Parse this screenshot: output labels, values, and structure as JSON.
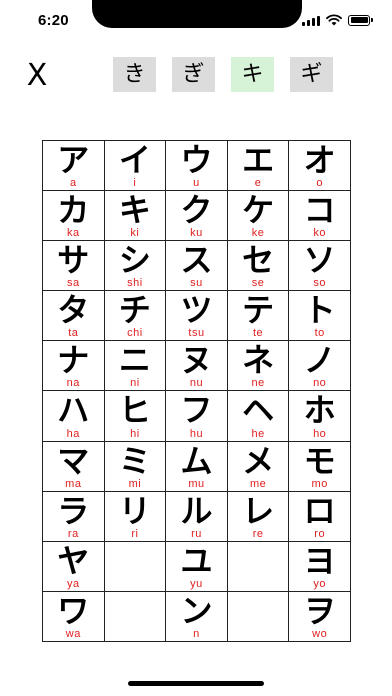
{
  "status_bar": {
    "time": "6:20"
  },
  "toolbar": {
    "close_label": "X",
    "tabs": [
      {
        "label": "き",
        "active": false
      },
      {
        "label": "ぎ",
        "active": false
      },
      {
        "label": "キ",
        "active": true
      },
      {
        "label": "ギ",
        "active": false
      }
    ]
  },
  "colors": {
    "romaji": "#e02020",
    "tab_inactive": "#dcdcdc",
    "tab_active": "#d7f3d7"
  },
  "grid": {
    "rows": [
      [
        {
          "kana": "ア",
          "romaji": "a"
        },
        {
          "kana": "イ",
          "romaji": "i"
        },
        {
          "kana": "ウ",
          "romaji": "u"
        },
        {
          "kana": "エ",
          "romaji": "e"
        },
        {
          "kana": "オ",
          "romaji": "o"
        }
      ],
      [
        {
          "kana": "カ",
          "romaji": "ka"
        },
        {
          "kana": "キ",
          "romaji": "ki"
        },
        {
          "kana": "ク",
          "romaji": "ku"
        },
        {
          "kana": "ケ",
          "romaji": "ke"
        },
        {
          "kana": "コ",
          "romaji": "ko"
        }
      ],
      [
        {
          "kana": "サ",
          "romaji": "sa"
        },
        {
          "kana": "シ",
          "romaji": "shi"
        },
        {
          "kana": "ス",
          "romaji": "su"
        },
        {
          "kana": "セ",
          "romaji": "se"
        },
        {
          "kana": "ソ",
          "romaji": "so"
        }
      ],
      [
        {
          "kana": "タ",
          "romaji": "ta"
        },
        {
          "kana": "チ",
          "romaji": "chi"
        },
        {
          "kana": "ツ",
          "romaji": "tsu"
        },
        {
          "kana": "テ",
          "romaji": "te"
        },
        {
          "kana": "ト",
          "romaji": "to"
        }
      ],
      [
        {
          "kana": "ナ",
          "romaji": "na"
        },
        {
          "kana": "ニ",
          "romaji": "ni"
        },
        {
          "kana": "ヌ",
          "romaji": "nu"
        },
        {
          "kana": "ネ",
          "romaji": "ne"
        },
        {
          "kana": "ノ",
          "romaji": "no"
        }
      ],
      [
        {
          "kana": "ハ",
          "romaji": "ha"
        },
        {
          "kana": "ヒ",
          "romaji": "hi"
        },
        {
          "kana": "フ",
          "romaji": "hu"
        },
        {
          "kana": "ヘ",
          "romaji": "he"
        },
        {
          "kana": "ホ",
          "romaji": "ho"
        }
      ],
      [
        {
          "kana": "マ",
          "romaji": "ma"
        },
        {
          "kana": "ミ",
          "romaji": "mi"
        },
        {
          "kana": "ム",
          "romaji": "mu"
        },
        {
          "kana": "メ",
          "romaji": "me"
        },
        {
          "kana": "モ",
          "romaji": "mo"
        }
      ],
      [
        {
          "kana": "ラ",
          "romaji": "ra"
        },
        {
          "kana": "リ",
          "romaji": "ri"
        },
        {
          "kana": "ル",
          "romaji": "ru"
        },
        {
          "kana": "レ",
          "romaji": "re"
        },
        {
          "kana": "ロ",
          "romaji": "ro"
        }
      ],
      [
        {
          "kana": "ヤ",
          "romaji": "ya"
        },
        {
          "kana": "",
          "romaji": ""
        },
        {
          "kana": "ユ",
          "romaji": "yu"
        },
        {
          "kana": "",
          "romaji": ""
        },
        {
          "kana": "ヨ",
          "romaji": "yo"
        }
      ],
      [
        {
          "kana": "ワ",
          "romaji": "wa"
        },
        {
          "kana": "",
          "romaji": ""
        },
        {
          "kana": "ン",
          "romaji": "n"
        },
        {
          "kana": "",
          "romaji": ""
        },
        {
          "kana": "ヲ",
          "romaji": "wo"
        }
      ]
    ]
  }
}
